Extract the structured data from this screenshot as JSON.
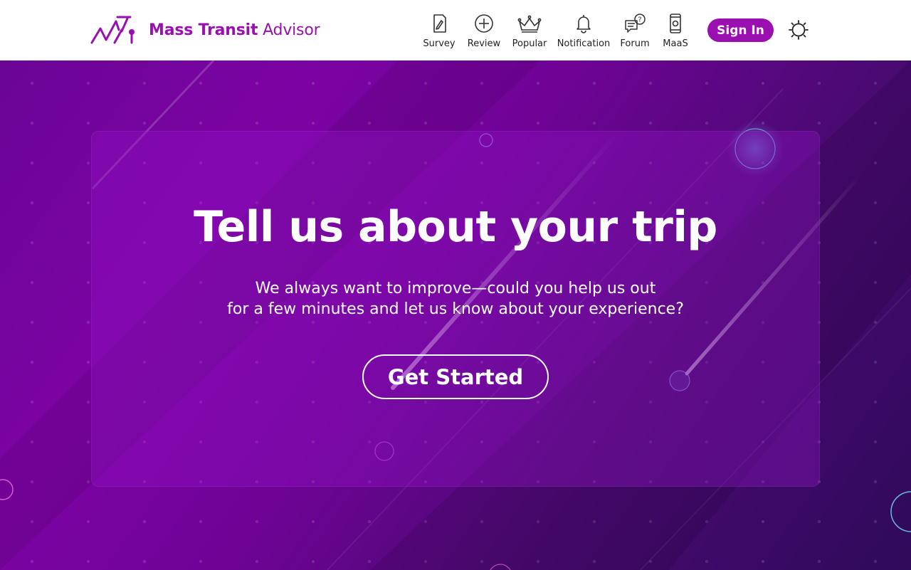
{
  "brand": {
    "name_strong": "Mass Transit",
    "name_light": "Advisor",
    "logo_icon": "mta-logo-icon",
    "color": "#9a0fb0"
  },
  "nav": {
    "items": [
      {
        "label": "Survey",
        "icon": "survey-icon"
      },
      {
        "label": "Review",
        "icon": "plus-circle-icon"
      },
      {
        "label": "Popular",
        "icon": "crown-icon"
      },
      {
        "label": "Notification",
        "icon": "bell-icon"
      },
      {
        "label": "Forum",
        "icon": "forum-chat-icon"
      },
      {
        "label": "MaaS",
        "icon": "phone-icon"
      }
    ],
    "signin_label": "Sign In",
    "theme_toggle_icon": "sun-icon"
  },
  "hero": {
    "title": "Tell us about your trip",
    "subtitle_line1": "We always want to improve—could you help us out",
    "subtitle_line2": "for a few minutes and let us know about your experience?",
    "cta_label": "Get Started"
  },
  "colors": {
    "accent": "#9a0fb0",
    "hero_gradient_start": "#6a0596",
    "hero_gradient_end": "#2e0a5a"
  }
}
